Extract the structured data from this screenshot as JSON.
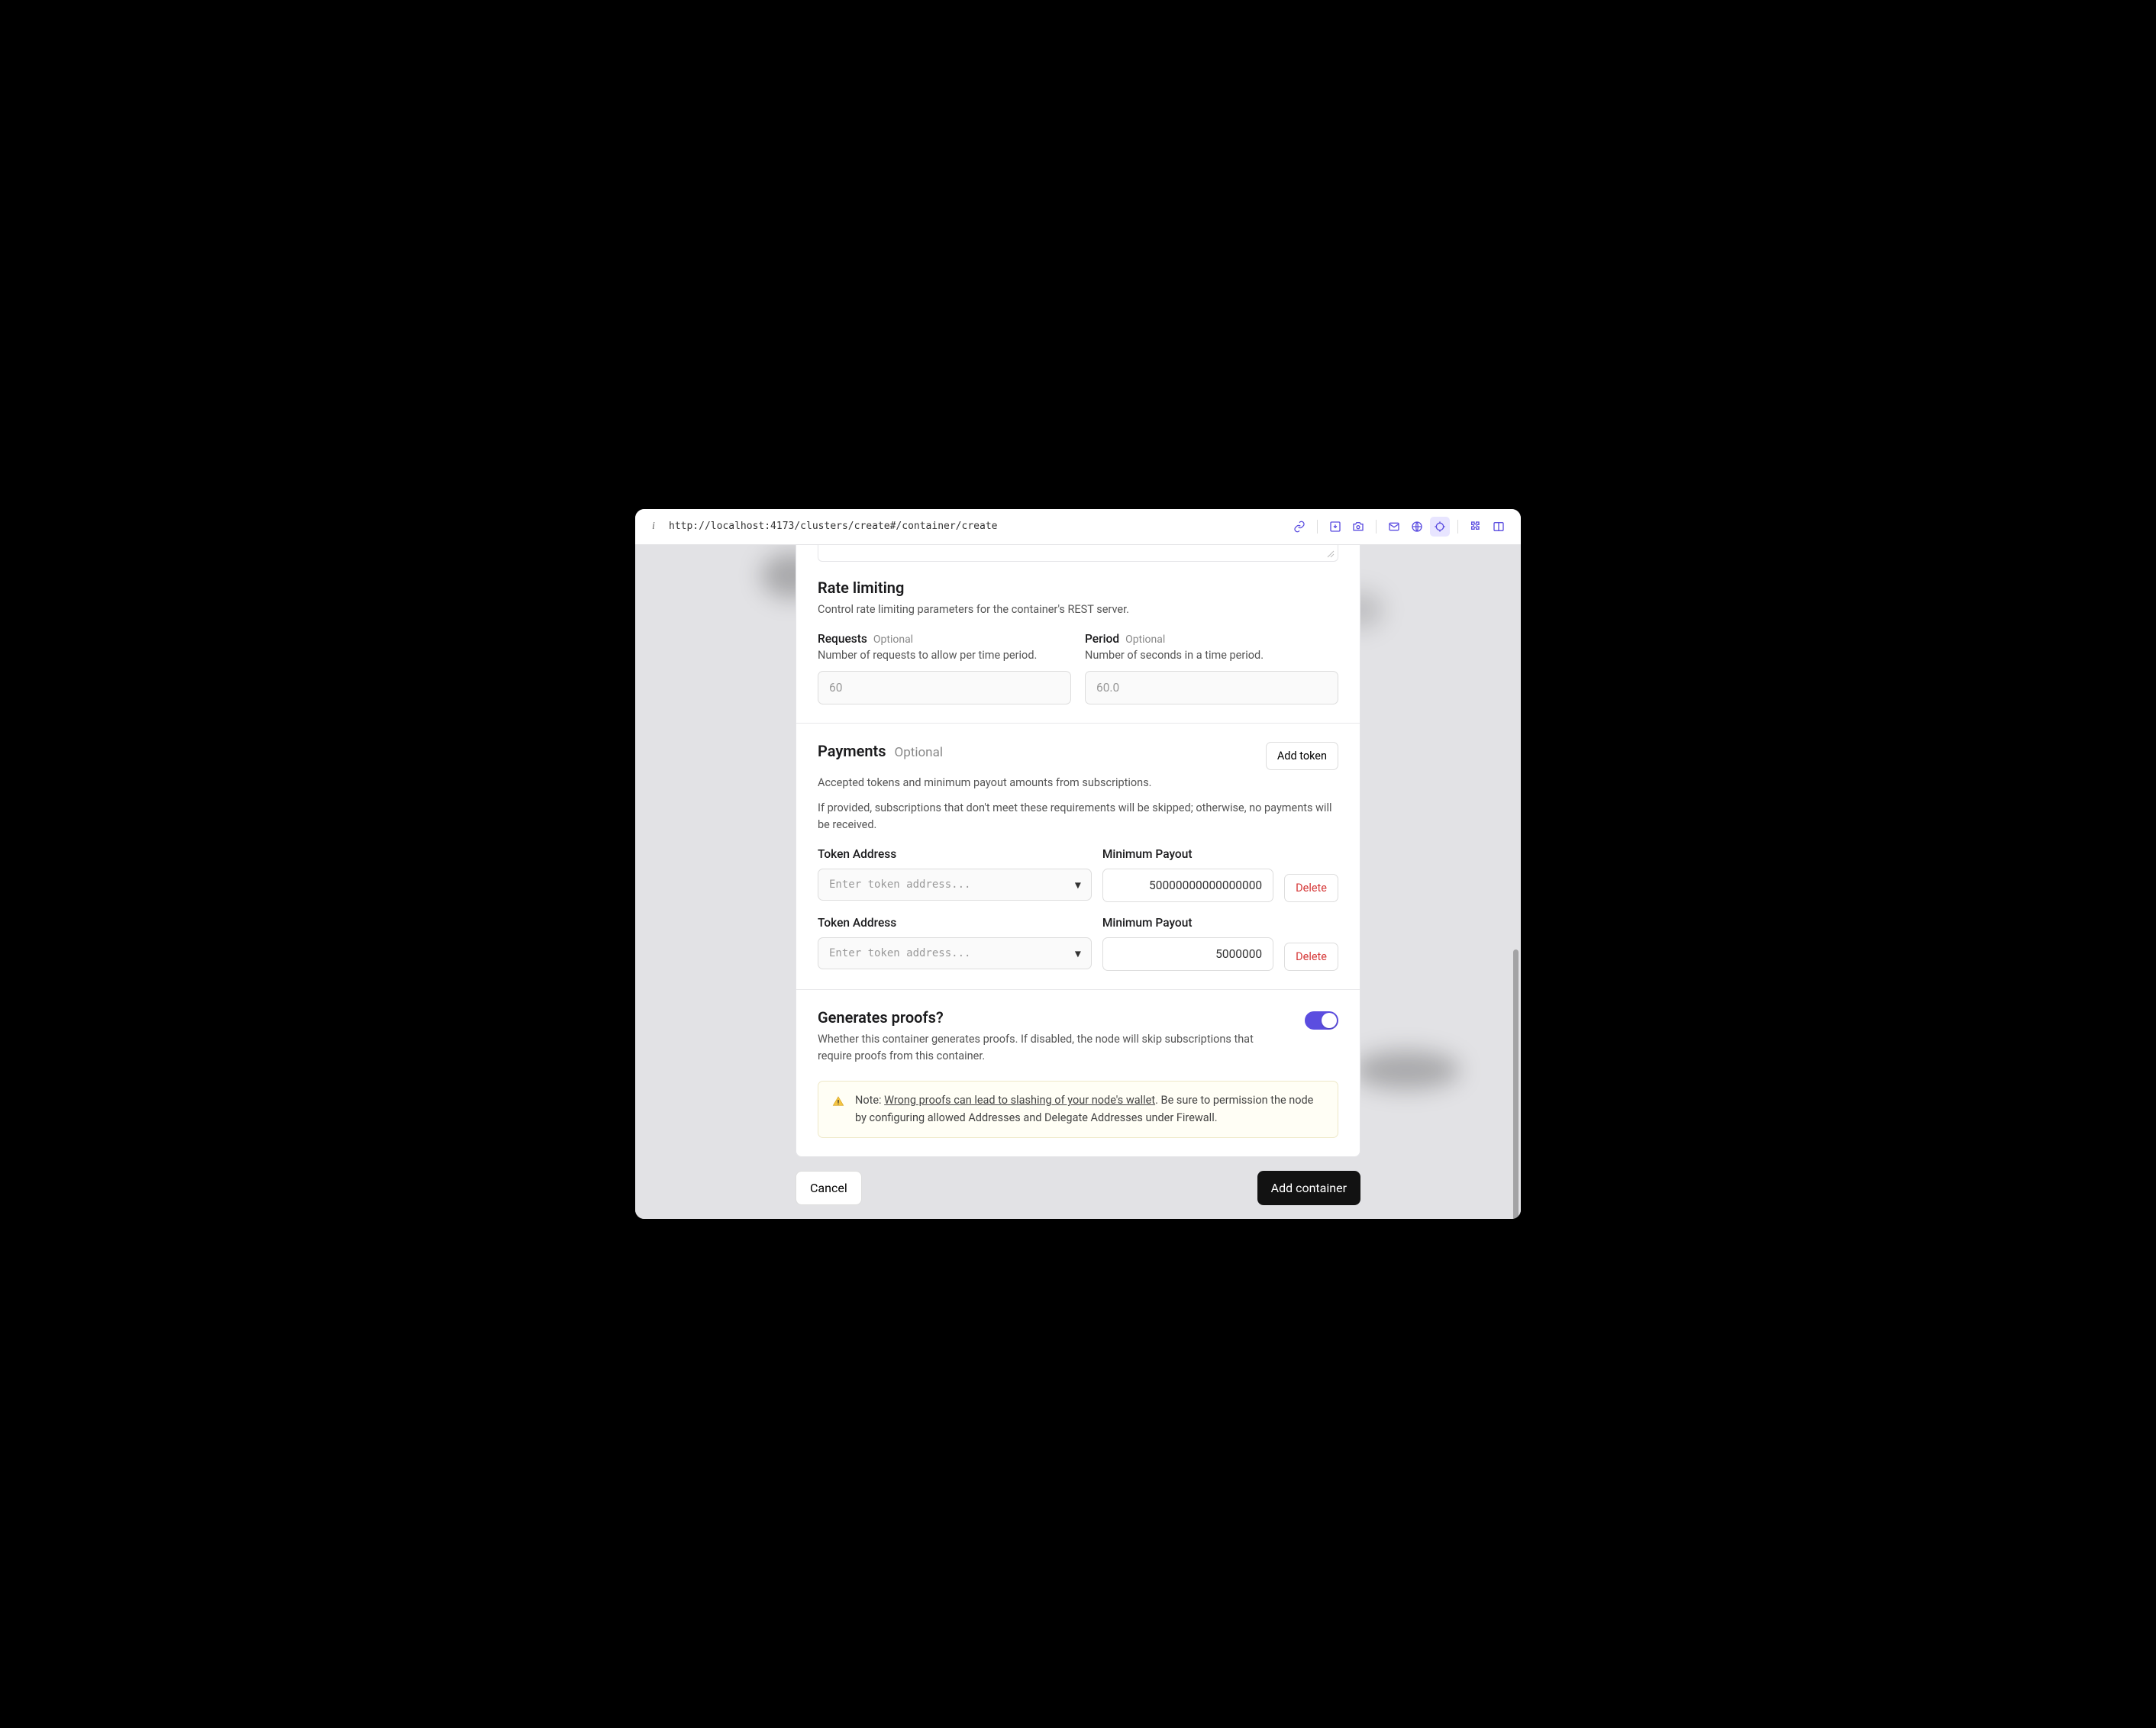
{
  "browser": {
    "url": "http://localhost:4173/clusters/create#/container/create"
  },
  "rateLimiting": {
    "title": "Rate limiting",
    "desc": "Control rate limiting parameters for the container's REST server.",
    "requests": {
      "label": "Requests",
      "optional": "Optional",
      "hint": "Number of requests to allow per time period.",
      "placeholder": "60"
    },
    "period": {
      "label": "Period",
      "optional": "Optional",
      "hint": "Number of seconds in a time period.",
      "placeholder": "60.0"
    }
  },
  "payments": {
    "title": "Payments",
    "optional": "Optional",
    "addTokenLabel": "Add token",
    "desc": "Accepted tokens and minimum payout amounts from subscriptions.",
    "extra": "If provided, subscriptions that don't meet these requirements will be skipped; otherwise, no payments will be received.",
    "tokenAddressLabel": "Token Address",
    "minPayoutLabel": "Minimum Payout",
    "tokenPlaceholder": "Enter token address...",
    "deleteLabel": "Delete",
    "rows": [
      {
        "tokenAddress": "",
        "minPayout": "50000000000000000"
      },
      {
        "tokenAddress": "",
        "minPayout": "5000000"
      }
    ]
  },
  "proofs": {
    "title": "Generates proofs?",
    "desc": "Whether this container generates proofs. If disabled, the node will skip subscriptions that require proofs from this container.",
    "notePrefix": "Note: ",
    "noteUnderlined": "Wrong proofs can lead to slashing of your node's wallet",
    "noteSuffix": ". Be sure to permission the node by configuring allowed Addresses and Delegate Addresses under Firewall.",
    "enabled": true
  },
  "footer": {
    "cancel": "Cancel",
    "submit": "Add container"
  }
}
